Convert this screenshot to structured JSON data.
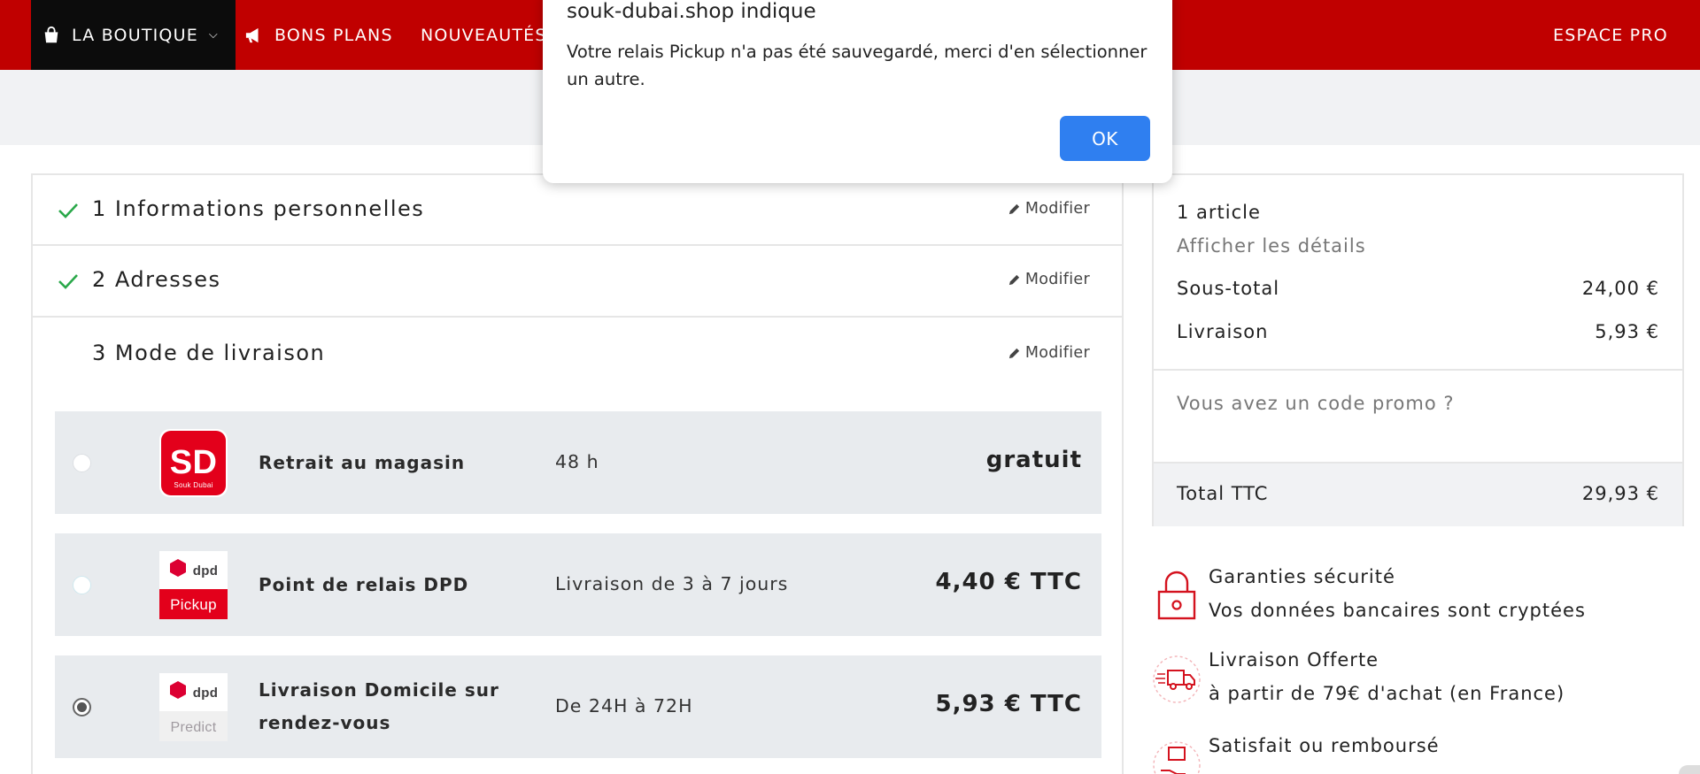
{
  "nav": {
    "boutique_label": "LA BOUTIQUE",
    "bons_plans_label": "BONS PLANS",
    "nouveautes_label": "NOUVEAUTÉS",
    "espace_pro_label": "ESPACE PRO",
    "nav_color": "#c00000",
    "boutique_bg": "#0c0c0c"
  },
  "dialog": {
    "title": "souk-dubai.shop indique",
    "message": "Votre relais Pickup n'a pas été sauvegardé, merci d'en sélectionner un autre.",
    "ok_label": "OK",
    "ok_color": "#2f7ff0"
  },
  "steps": [
    {
      "title": "1 Informations personnelles",
      "modify_label": "Modifier",
      "complete": true
    },
    {
      "title": "2 Adresses",
      "modify_label": "Modifier",
      "complete": true
    },
    {
      "title": "3 Mode de livraison",
      "modify_label": "Modifier",
      "complete": false
    }
  ],
  "carriers": [
    {
      "name": "Retrait au magasin",
      "delay": "48 h",
      "price": "gratuit",
      "logo_text": "SD",
      "logo_sub": "Souk Dubai",
      "selected": false
    },
    {
      "name": "Point de relais DPD",
      "delay": "Livraison de 3 à 7 jours",
      "price": "4,40 € TTC",
      "logo_text": "dpd",
      "logo_sub": "Pickup",
      "selected": false
    },
    {
      "name_line1": "Livraison Domicile sur",
      "name_line2": "rendez-vous",
      "delay": "De 24H à 72H",
      "price": "5,93 € TTC",
      "logo_text": "dpd",
      "logo_sub": "Predict",
      "selected": true
    }
  ],
  "summary": {
    "article_count": "1 article",
    "details_link": "Afficher les détails",
    "subtotal_label": "Sous-total",
    "subtotal_value": "24,00 €",
    "shipping_label": "Livraison",
    "shipping_value": "5,93 €",
    "promo_link": "Vous avez un code promo ?",
    "total_label": "Total TTC",
    "total_value": "29,93 €"
  },
  "reassurance": [
    {
      "title": "Garanties sécurité",
      "text": "Vos données bancaires sont cryptées",
      "icon": "lock-icon"
    },
    {
      "title": "Livraison Offerte",
      "text": "à partir de 79€ d'achat (en France)",
      "icon": "delivery-truck-icon"
    },
    {
      "title": "Satisfait ou remboursé",
      "icon": "box-hand-icon"
    }
  ]
}
